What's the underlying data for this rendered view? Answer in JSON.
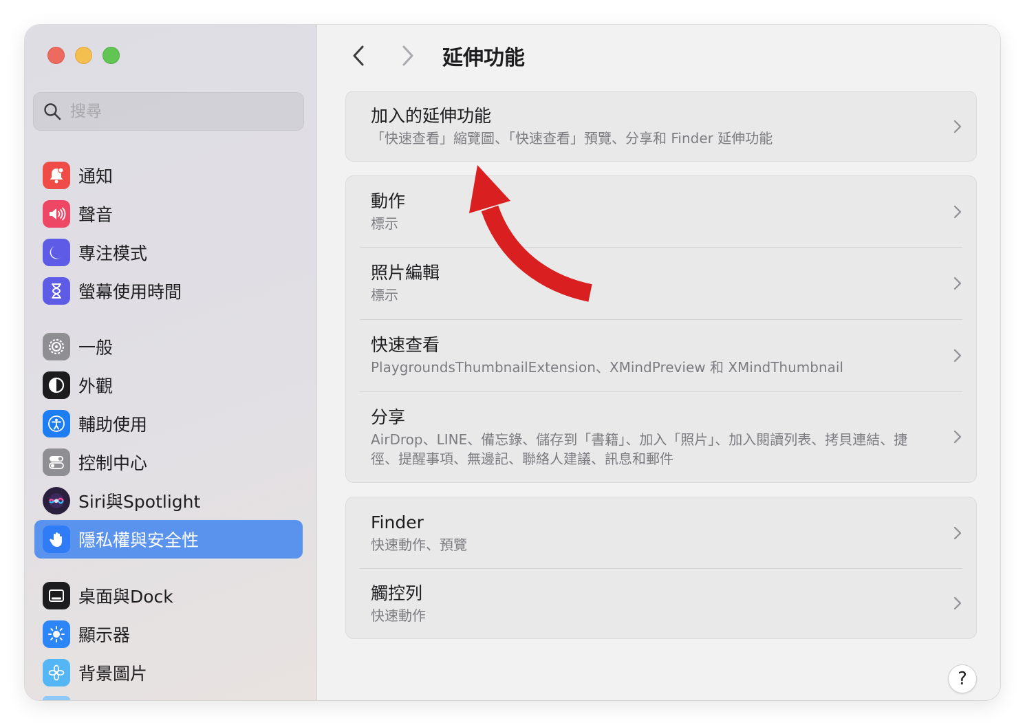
{
  "search": {
    "placeholder": "搜尋"
  },
  "sidebar": {
    "items": [
      {
        "label": "通知",
        "icon": "bell-badge-icon",
        "color": "#ef4c48"
      },
      {
        "label": "聲音",
        "icon": "speaker-wave-icon",
        "color": "#ee4766"
      },
      {
        "label": "專注模式",
        "icon": "moon-icon",
        "color": "#5e5ce6"
      },
      {
        "label": "螢幕使用時間",
        "icon": "hourglass-icon",
        "color": "#5e5ce6"
      },
      {
        "label": "一般",
        "icon": "gear-icon",
        "color": "#8e8e93"
      },
      {
        "label": "外觀",
        "icon": "appearance-circle-icon",
        "color": "#1c1c1e"
      },
      {
        "label": "輔助使用",
        "icon": "accessibility-person-icon",
        "color": "#1d7df2"
      },
      {
        "label": "控制中心",
        "icon": "toggle-switches-icon",
        "color": "#8e8e93"
      },
      {
        "label": "Siri與Spotlight",
        "icon": "siri-orb-icon",
        "color": "#2a1f3d"
      },
      {
        "label": "隱私權與安全性",
        "icon": "raised-hand-icon",
        "color": "#2f7cf6",
        "selected": true
      },
      {
        "label": "桌面與Dock",
        "icon": "dock-icon",
        "color": "#1c1c1e"
      },
      {
        "label": "顯示器",
        "icon": "sun-brightness-icon",
        "color": "#2d86f7"
      },
      {
        "label": "背景圖片",
        "icon": "flower-icon",
        "color": "#54b6f5"
      }
    ]
  },
  "toolbar": {
    "title": "延伸功能"
  },
  "main": {
    "cards": [
      {
        "rows": [
          {
            "title": "加入的延伸功能",
            "subtitle": "「快速查看」縮覽圖、「快速查看」預覽、分享和 Finder 延伸功能"
          }
        ]
      },
      {
        "rows": [
          {
            "title": "動作",
            "subtitle": "標示"
          },
          {
            "title": "照片編輯",
            "subtitle": "標示"
          },
          {
            "title": "快速查看",
            "subtitle": "PlaygroundsThumbnailExtension、XMindPreview 和 XMindThumbnail"
          },
          {
            "title": "分享",
            "subtitle": "AirDrop、LINE、備忘錄、儲存到「書籍」、加入「照片」、加入閱讀列表、拷貝連結、捷徑、提醒事項、無邊記、聯絡人建議、訊息和郵件"
          }
        ]
      },
      {
        "rows": [
          {
            "title": "Finder",
            "subtitle": "快速動作、預覽"
          },
          {
            "title": "觸控列",
            "subtitle": "快速動作"
          }
        ]
      }
    ]
  },
  "help": {
    "label": "?"
  },
  "colors": {
    "accent": "#5a93ed",
    "annotation_arrow": "#d91f1f"
  }
}
